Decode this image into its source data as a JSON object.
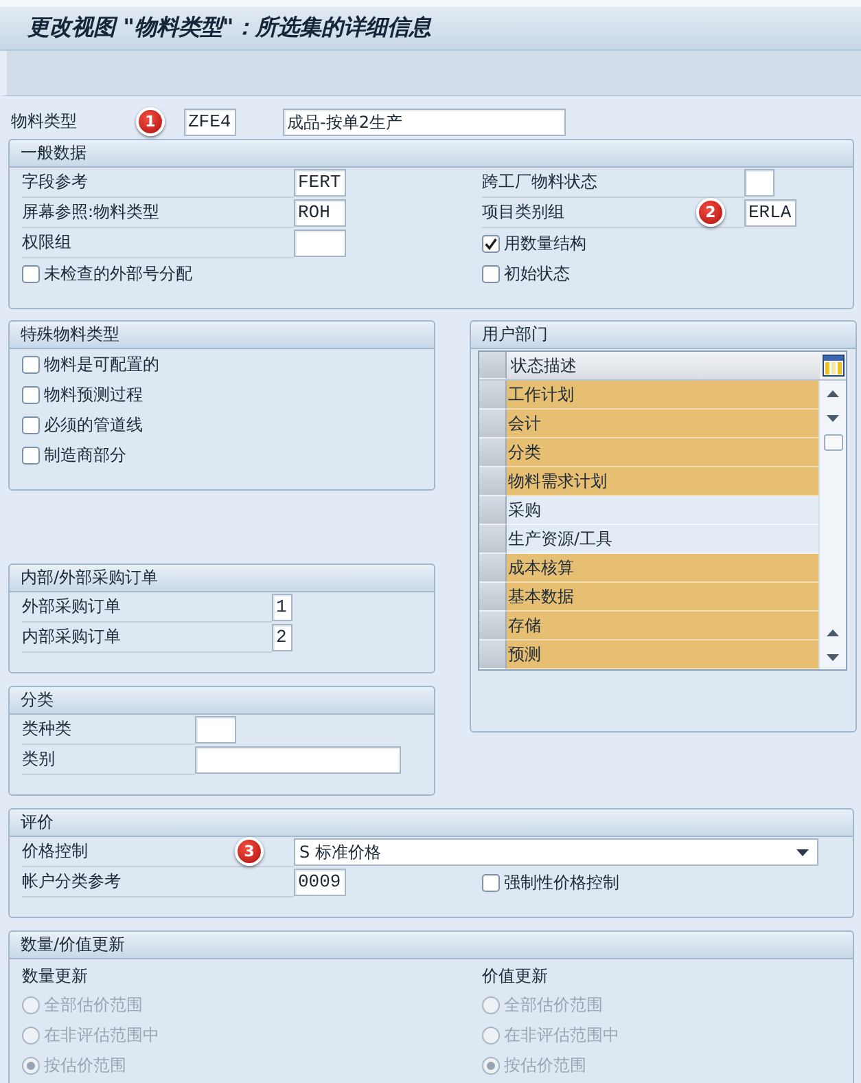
{
  "window": {
    "title": "更改视图 \"物料类型\"：所选集的详细信息"
  },
  "material_type": {
    "label": "物料类型",
    "marker": "1",
    "code": "ZFE4",
    "description": "成品-按单2生产"
  },
  "general_data": {
    "title": "一般数据",
    "columns": [
      [
        {
          "kind": "field",
          "label": "字段参考",
          "value": "FERT"
        },
        {
          "kind": "field",
          "label": "屏幕参照:物料类型",
          "value": "ROH"
        },
        {
          "kind": "field",
          "label": "权限组"
        },
        {
          "kind": "checkbox",
          "label": "未检查的外部号分配",
          "checked": false
        }
      ],
      [
        {
          "kind": "field",
          "label": "跨工厂物料状态"
        },
        {
          "kind": "field",
          "label": "项目类别组",
          "value": "ERLA",
          "marker": "2"
        },
        {
          "kind": "checkbox",
          "label": "用数量结构",
          "checked": true
        },
        {
          "kind": "checkbox",
          "label": "初始状态",
          "checked": false
        }
      ]
    ]
  },
  "special_material_types": {
    "title": "特殊物料类型",
    "items": [
      {
        "kind": "checkbox",
        "label": "物料是可配置的",
        "checked": false
      },
      {
        "kind": "checkbox",
        "label": "物料预测过程",
        "checked": false
      },
      {
        "kind": "checkbox",
        "label": "必须的管道线",
        "checked": false
      },
      {
        "kind": "checkbox",
        "label": "制造商部分",
        "checked": false
      }
    ]
  },
  "user_departments": {
    "title": "用户部门",
    "column": "状态描述",
    "rows": [
      {
        "label": "工作计划",
        "selected": true
      },
      {
        "label": "会计",
        "selected": true
      },
      {
        "label": "分类",
        "selected": true
      },
      {
        "label": "物料需求计划",
        "selected": true
      },
      {
        "label": "采购",
        "selected": false
      },
      {
        "label": "生产资源/工具",
        "selected": false
      },
      {
        "label": "成本核算",
        "selected": true
      },
      {
        "label": "基本数据",
        "selected": true
      },
      {
        "label": "存储",
        "selected": true
      },
      {
        "label": "预测",
        "selected": true
      }
    ]
  },
  "purchase_orders": {
    "title": "内部/外部采购订单",
    "items": [
      {
        "kind": "field",
        "label": "外部采购订单",
        "value": "1"
      },
      {
        "kind": "field",
        "label": "内部采购订单",
        "value": "2"
      }
    ]
  },
  "classification": {
    "title": "分类",
    "items": [
      {
        "kind": "field",
        "label": "类种类"
      },
      {
        "kind": "field",
        "label": "类别"
      }
    ]
  },
  "valuation": {
    "title": "评价",
    "rows": [
      [
        {
          "kind": "dropdown",
          "label": "价格控制",
          "marker": "3",
          "value": "S 标准价格"
        }
      ],
      [
        {
          "kind": "field",
          "label": "帐户分类参考",
          "value": "0009"
        },
        {
          "kind": "checkbox",
          "label": "强制性价格控制",
          "checked": false
        }
      ]
    ]
  },
  "quantity_value_update": {
    "title": "数量/价值更新",
    "groups": [
      {
        "title": "数量更新",
        "options": [
          {
            "label": "全部估价范围",
            "selected": false,
            "disabled": true
          },
          {
            "label": "在非评估范围中",
            "selected": false,
            "disabled": true
          },
          {
            "label": "按估价范围",
            "selected": true,
            "disabled": true
          }
        ]
      },
      {
        "title": "价值更新",
        "options": [
          {
            "label": "全部估价范围",
            "selected": false,
            "disabled": true
          },
          {
            "label": "在非评估范围中",
            "selected": false,
            "disabled": true
          },
          {
            "label": "按估价范围",
            "selected": true,
            "disabled": true
          }
        ]
      }
    ]
  }
}
